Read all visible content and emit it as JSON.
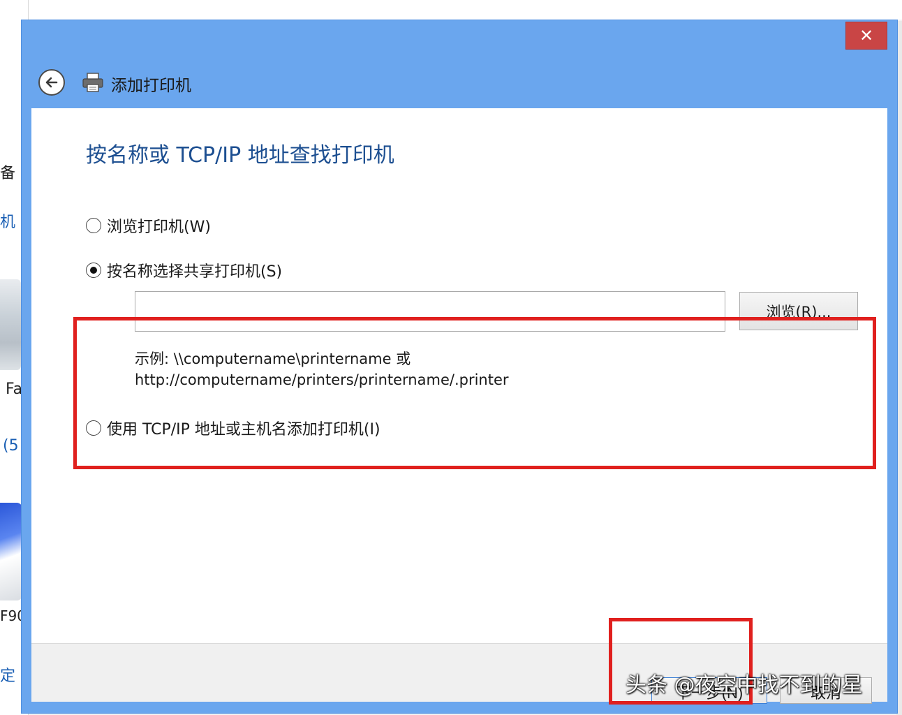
{
  "dialog": {
    "title": "添加打印机",
    "close_glyph": "✕",
    "heading": "按名称或 TCP/IP 地址查找打印机",
    "options": {
      "browse": "浏览打印机(W)",
      "by_name": "按名称选择共享打印机(S)",
      "tcpip": "使用 TCP/IP 地址或主机名添加打印机(I)"
    },
    "selected_option": "by_name",
    "name_input_value": "",
    "browse_button": "浏览(R)...",
    "example_line1": "示例: \\\\computername\\printername 或",
    "example_line2": "http://computername/printers/printername/.printer",
    "next_button": "下一步(N)",
    "cancel_button": "取消"
  },
  "background": {
    "frag1": "备",
    "frag2": "机",
    "frag3": "Fa",
    "frag4": "(5",
    "frag5": "F90",
    "frag6": "定"
  },
  "watermark": "头条 @夜空中找不到的星",
  "colors": {
    "title_bar": "#6aa6ee",
    "close_button": "#c94545",
    "heading": "#1d4f91",
    "annotation": "#e0201e"
  }
}
